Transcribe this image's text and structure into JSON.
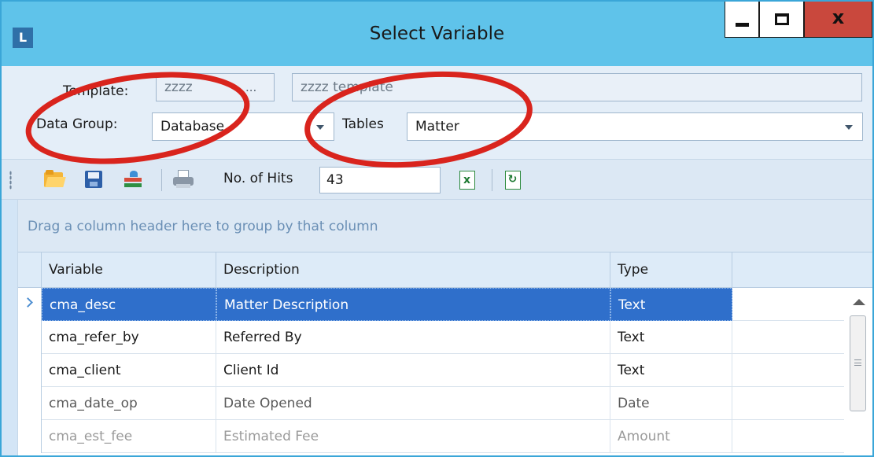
{
  "window": {
    "title": "Select Variable",
    "app_icon": "logo-icon",
    "controls": {
      "minimize": "minimize-icon",
      "maximize": "maximize-icon",
      "close_glyph": "x"
    }
  },
  "form": {
    "template_label": "Template:",
    "template_code": "zzzz",
    "template_browse": "...",
    "template_name": "zzzz template",
    "data_group_label": "Data Group:",
    "data_group_value": "Database",
    "tables_label": "Tables",
    "tables_value": "Matter"
  },
  "toolbar": {
    "icons": [
      "open-folder-icon",
      "save-icon",
      "users-icon",
      "print-icon",
      "export-excel-icon",
      "refresh-icon"
    ],
    "hits_label": "No. of Hits",
    "hits_value": "43"
  },
  "grid": {
    "group_hint": "Drag a column header here to group by that column",
    "columns": [
      "Variable",
      "Description",
      "Type"
    ],
    "rows": [
      {
        "variable": "cma_desc",
        "description": "Matter Description",
        "type": "Text"
      },
      {
        "variable": "cma_refer_by",
        "description": "Referred By",
        "type": "Text"
      },
      {
        "variable": "cma_client",
        "description": "Client Id",
        "type": "Text"
      },
      {
        "variable": "cma_date_op",
        "description": "Date Opened",
        "type": "Date"
      },
      {
        "variable": "cma_est_fee",
        "description": "Estimated Fee",
        "type": "Amount"
      }
    ]
  },
  "colors": {
    "titlebar": "#5fc3ea",
    "selection": "#2f6fcb",
    "annotation": "#d9241d",
    "close_button": "#c9483d"
  }
}
